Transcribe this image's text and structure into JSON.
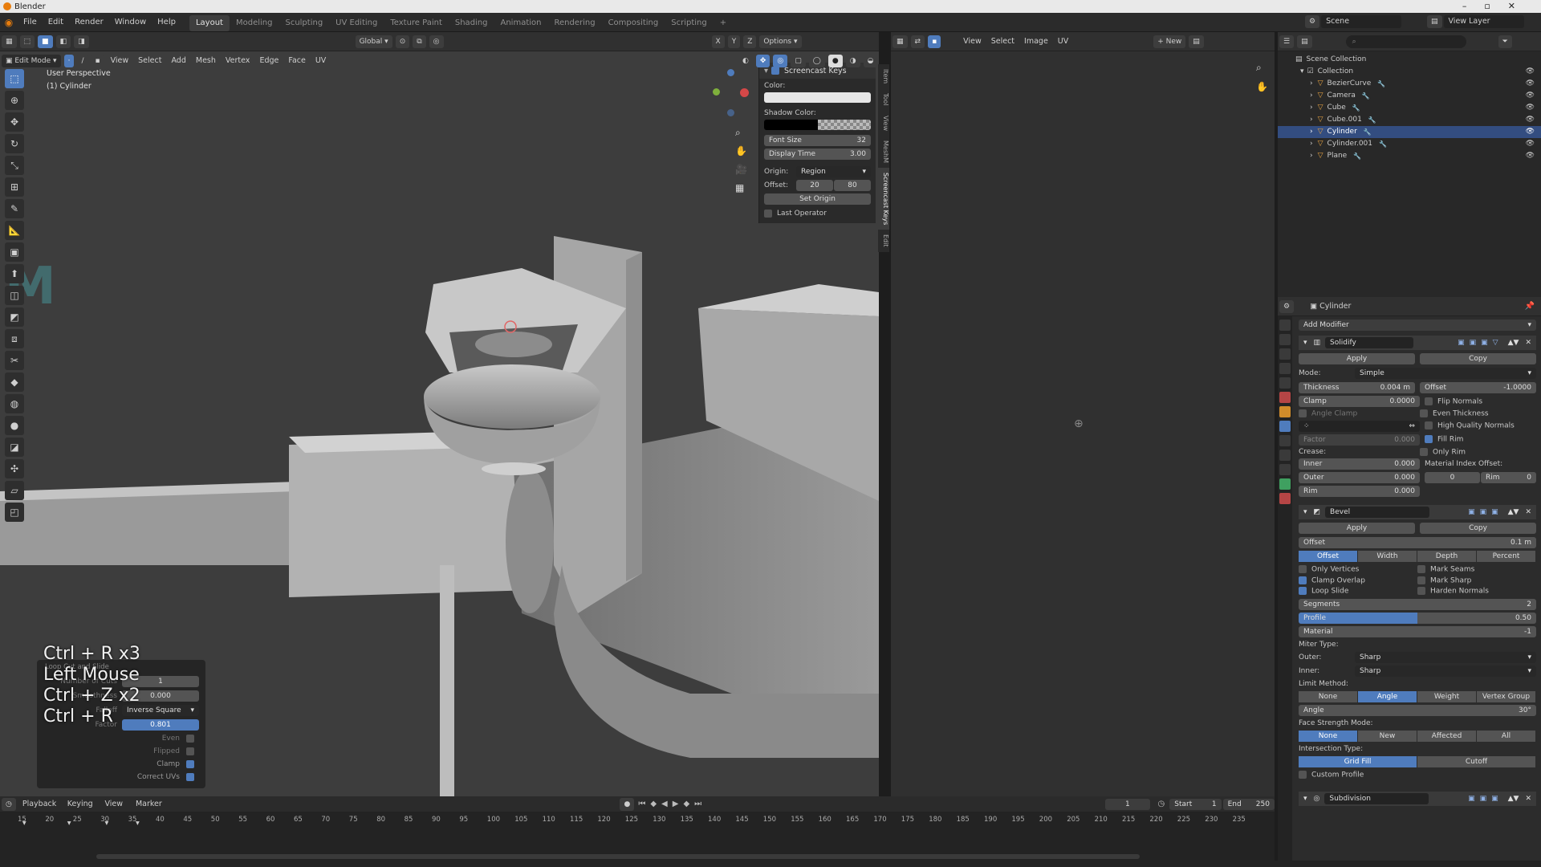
{
  "window": {
    "title": "Blender"
  },
  "menus": [
    "File",
    "Edit",
    "Render",
    "Window",
    "Help"
  ],
  "workspaces": [
    "Layout",
    "Modeling",
    "Sculpting",
    "UV Editing",
    "Texture Paint",
    "Shading",
    "Animation",
    "Rendering",
    "Compositing",
    "Scripting",
    "+"
  ],
  "scene": {
    "label": "Scene",
    "view_layer": "View Layer"
  },
  "viewport": {
    "mode": "Edit Mode",
    "menu": [
      "View",
      "Select",
      "Add",
      "Mesh",
      "Vertex",
      "Edge",
      "Face",
      "UV"
    ],
    "orientation": "Global",
    "options": "Options",
    "axes": [
      "X",
      "Y",
      "Z"
    ],
    "perspective": "User Perspective",
    "object": "(1) Cylinder",
    "watermark": "M"
  },
  "screencast": {
    "title": "Screencast Keys",
    "color_label": "Color:",
    "shadow_label": "Shadow Color:",
    "font_size_label": "Font Size",
    "font_size": "32",
    "display_time_label": "Display Time",
    "display_time": "3.00",
    "origin_label": "Origin:",
    "origin": "Region",
    "offset_label": "Offset:",
    "offset_x": "20",
    "offset_y": "80",
    "set_origin": "Set Origin",
    "last_operator": "Last Operator",
    "tabs": [
      "Item",
      "Tool",
      "View",
      "MeshM",
      "Screencast Keys",
      "Edit"
    ]
  },
  "keystrokes": [
    "Ctrl + R x3",
    "Left Mouse",
    "Ctrl + Z x2",
    "Ctrl + R"
  ],
  "loopcut": {
    "title": "Loop Cut and Slide",
    "cuts_label": "Number of Cuts",
    "cuts": "1",
    "smooth_label": "Smoothness",
    "smooth": "0.000",
    "falloff_label": "Falloff",
    "falloff": "Inverse Square",
    "factor_label": "Factor",
    "factor": "0.801",
    "even": "Even",
    "flipped": "Flipped",
    "clamp": "Clamp",
    "correct_uvs": "Correct UVs"
  },
  "image_editor": {
    "menu": [
      "View",
      "Select",
      "Image",
      "UV"
    ],
    "new": "New"
  },
  "outliner": {
    "root": "Scene Collection",
    "collection": "Collection",
    "items": [
      "BezierCurve",
      "Camera",
      "Cube",
      "Cube.001",
      "Cylinder",
      "Cylinder.001",
      "Plane"
    ],
    "selected": "Cylinder"
  },
  "properties": {
    "object": "Cylinder",
    "add_modifier": "Add Modifier",
    "solidify": {
      "name": "Solidify",
      "apply": "Apply",
      "copy": "Copy",
      "mode_label": "Mode:",
      "mode": "Simple",
      "thickness_label": "Thickness",
      "thickness": "0.004 m",
      "offset_label": "Offset",
      "offset": "-1.0000",
      "clamp_label": "Clamp",
      "clamp": "0.0000",
      "angle_clamp": "Angle Clamp",
      "flip_normals": "Flip Normals",
      "even_thickness": "Even Thickness",
      "hq_normals": "High Quality Normals",
      "fill_rim": "Fill Rim",
      "only_rim": "Only Rim",
      "factor_label": "Factor",
      "factor": "0.000",
      "crease_label": "Crease:",
      "inner_label": "Inner",
      "inner": "0.000",
      "outer_label": "Outer",
      "outer": "0.000",
      "rim_label": "Rim",
      "rim": "0.000",
      "mat_index_label": "Material Index Offset:",
      "mat_index": "0",
      "mat_rim_label": "Rim",
      "mat_rim": "0"
    },
    "bevel": {
      "name": "Bevel",
      "apply": "Apply",
      "copy": "Copy",
      "offset_label": "Offset",
      "offset": "0.1 m",
      "width_types": [
        "Offset",
        "Width",
        "Depth",
        "Percent"
      ],
      "only_vertices": "Only Vertices",
      "mark_seams": "Mark Seams",
      "clamp_overlap": "Clamp Overlap",
      "mark_sharp": "Mark Sharp",
      "loop_slide": "Loop Slide",
      "harden_normals": "Harden Normals",
      "segments_label": "Segments",
      "segments": "2",
      "profile_label": "Profile",
      "profile": "0.50",
      "material_label": "Material",
      "material": "-1",
      "miter_label": "Miter Type:",
      "outer_label": "Outer:",
      "outer": "Sharp",
      "inner_label": "Inner:",
      "inner": "Sharp",
      "limit_label": "Limit Method:",
      "limit": [
        "None",
        "Angle",
        "Weight",
        "Vertex Group"
      ],
      "angle_label": "Angle",
      "angle": "30°",
      "face_strength_label": "Face Strength Mode:",
      "face_strength": [
        "None",
        "New",
        "Affected",
        "All"
      ],
      "intersection_label": "Intersection Type:",
      "intersection": [
        "Grid Fill",
        "Cutoff"
      ],
      "custom_profile": "Custom Profile"
    },
    "subdivision": {
      "name": "Subdivision"
    }
  },
  "timeline": {
    "menu": [
      "Playback",
      "Keying",
      "View",
      "Marker"
    ],
    "frame": "1",
    "start_label": "Start",
    "start": "1",
    "end_label": "End",
    "end": "250",
    "ticks": [
      "15",
      "20",
      "25",
      "30",
      "35",
      "40",
      "45",
      "50",
      "55",
      "60",
      "65",
      "70",
      "75",
      "80",
      "85",
      "90",
      "95",
      "100",
      "105",
      "110",
      "115",
      "120",
      "125",
      "130",
      "135",
      "140",
      "145",
      "150",
      "155",
      "160",
      "165",
      "170",
      "175",
      "180",
      "185",
      "190",
      "195",
      "200",
      "205",
      "210",
      "215",
      "220",
      "225",
      "230",
      "235"
    ]
  }
}
